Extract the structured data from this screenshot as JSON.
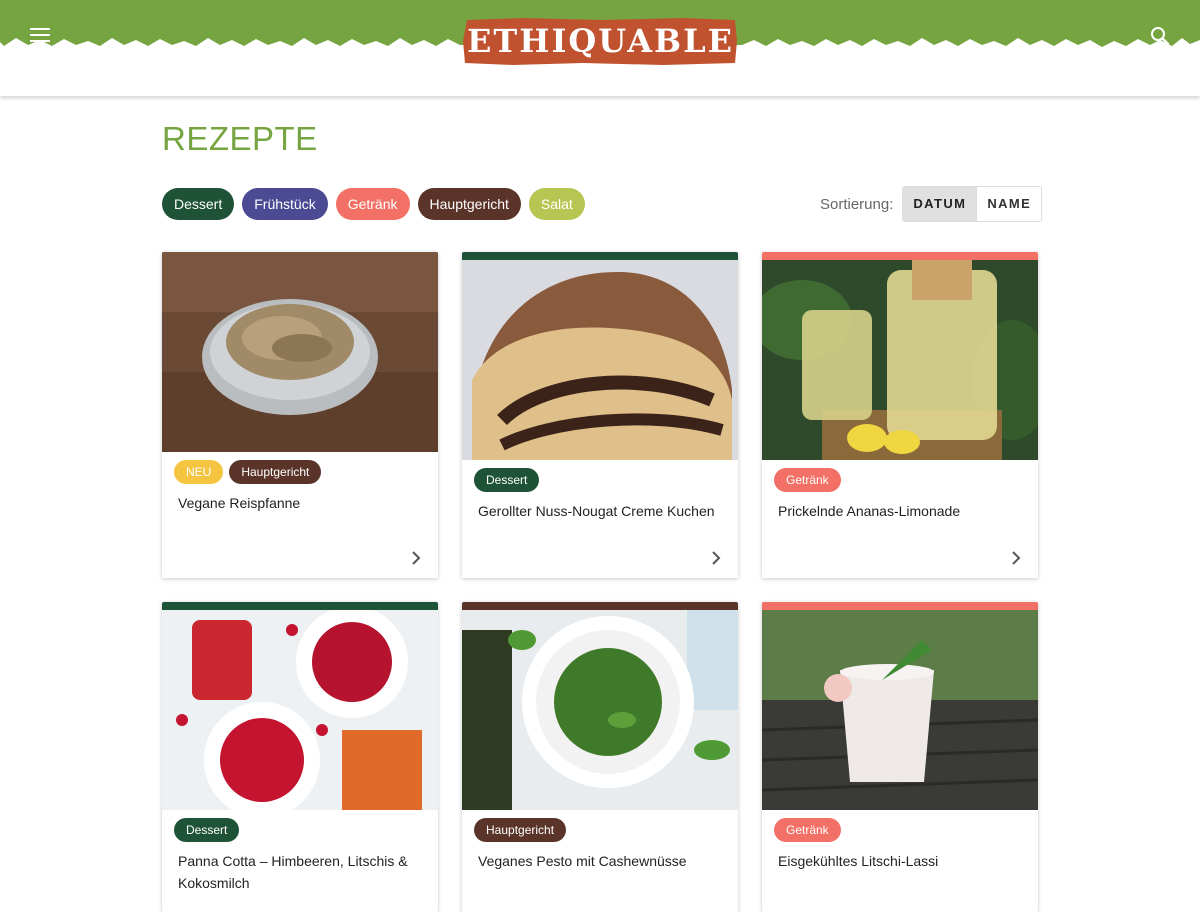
{
  "header": {
    "logo_text": "ETHIQUABLE",
    "menu_icon": "hamburger-menu-icon",
    "search_icon": "search-icon",
    "colors": {
      "grass": "#76a441",
      "logo": "#c0522f"
    }
  },
  "page": {
    "title": "REZEPTE"
  },
  "filters": [
    {
      "label": "Dessert",
      "color": "#1f5337"
    },
    {
      "label": "Frühstück",
      "color": "#4b4a92"
    },
    {
      "label": "Getränk",
      "color": "#f27065"
    },
    {
      "label": "Hauptgericht",
      "color": "#5a3429"
    },
    {
      "label": "Salat",
      "color": "#b7c652"
    }
  ],
  "sort": {
    "label": "Sortierung:",
    "options": [
      "DATUM",
      "NAME"
    ],
    "selected": "DATUM"
  },
  "cards": [
    {
      "title": "Vegane Reispfanne",
      "tags": [
        "NEU",
        "Hauptgericht"
      ],
      "image": "rice-bowl-photo"
    },
    {
      "title": "Gerollter Nuss-Nougat Creme Kuchen",
      "tags": [
        "Dessert"
      ],
      "image": "nougat-roll-cake-photo"
    },
    {
      "title": "Prickelnde Ananas-Limonade",
      "tags": [
        "Getränk"
      ],
      "image": "pineapple-lemonade-photo"
    },
    {
      "title": "Panna Cotta – Himbeeren, Litschis & Kokosmilch",
      "tags": [
        "Dessert"
      ],
      "image": "panna-cotta-photo"
    },
    {
      "title": "Veganes Pesto mit Cashewnüsse",
      "tags": [
        "Hauptgericht"
      ],
      "image": "pesto-soup-photo"
    },
    {
      "title": "Eisgekühltes Litschi-Lassi",
      "tags": [
        "Getränk"
      ],
      "image": "litchi-lassi-photo"
    }
  ],
  "tag_colors": {
    "NEU": "#f5c542",
    "Dessert": "#1f5337",
    "Hauptgericht": "#5a3429",
    "Getränk": "#f27065"
  }
}
